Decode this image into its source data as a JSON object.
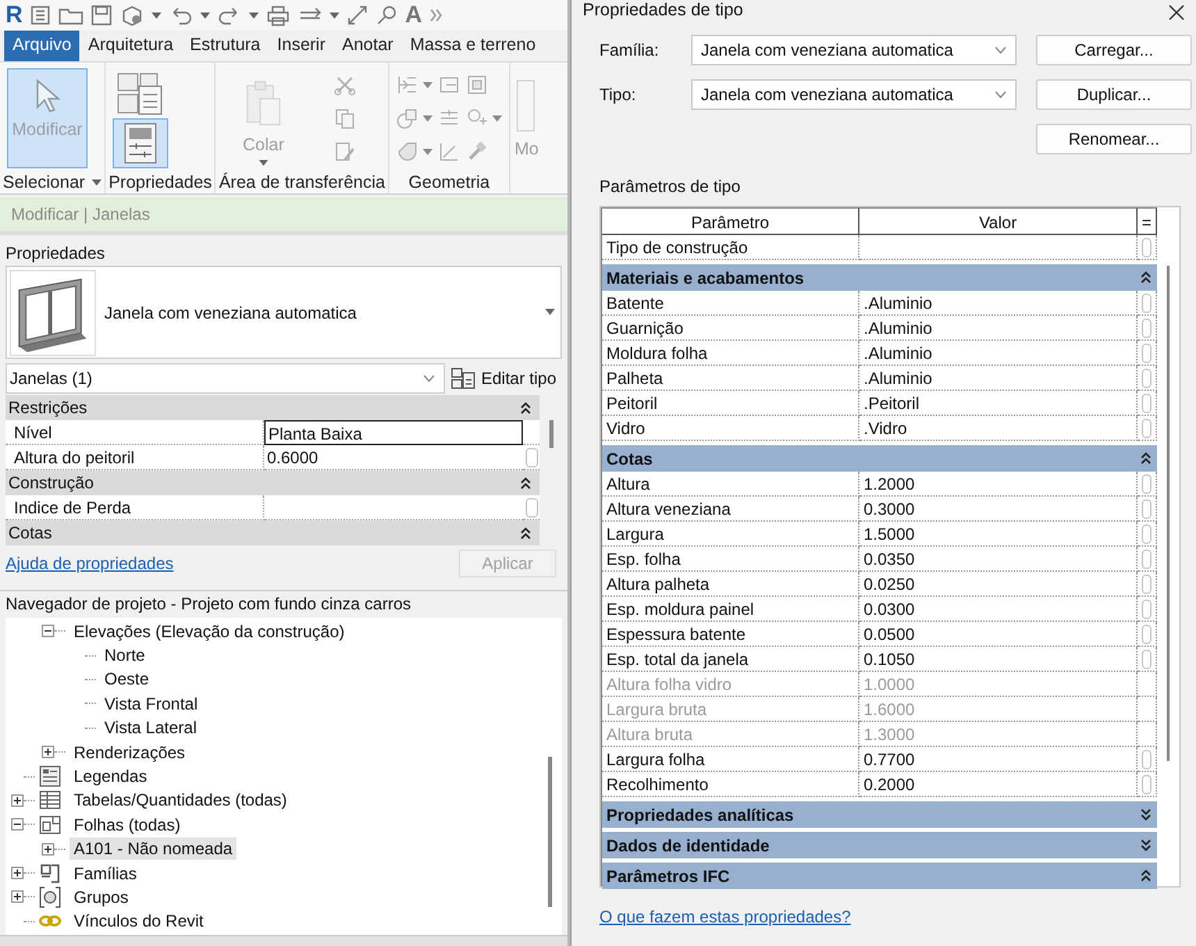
{
  "app": {
    "logo": "R",
    "text_tool": "A"
  },
  "ribbon": {
    "tabs": [
      {
        "label": "Arquivo",
        "selected": true
      },
      {
        "label": "Arquitetura",
        "selected": false
      },
      {
        "label": "Estrutura",
        "selected": false
      },
      {
        "label": "Inserir",
        "selected": false
      },
      {
        "label": "Anotar",
        "selected": false
      },
      {
        "label": "Massa e terreno",
        "selected": false
      }
    ],
    "panels": [
      {
        "label": "Selecionar",
        "dropdown": true,
        "tools": [
          {
            "kind": "large",
            "label": "Modificar",
            "selected": true,
            "disabled": true
          }
        ]
      },
      {
        "label": "Propriedades",
        "dropdown": false,
        "tools": [
          {
            "kind": "icon_large",
            "selected": false
          },
          {
            "kind": "icon_large",
            "selected": true
          }
        ]
      },
      {
        "label": "Área de transferência",
        "dropdown": false,
        "tools": [
          {
            "kind": "large",
            "label": "Colar",
            "selected": false,
            "disabled": true,
            "dropdown": true
          },
          {
            "kind": "small",
            "disabled": true
          },
          {
            "kind": "small",
            "disabled": true
          },
          {
            "kind": "small",
            "disabled": true
          }
        ]
      },
      {
        "label": "Geometria",
        "dropdown": false,
        "tools": [
          {
            "kind": "small",
            "disabled": true,
            "dropdown": true
          },
          {
            "kind": "small",
            "disabled": true,
            "dropdown": true
          },
          {
            "kind": "small",
            "disabled": true,
            "dropdown": true
          },
          {
            "kind": "small",
            "disabled": true
          },
          {
            "kind": "small",
            "disabled": true
          },
          {
            "kind": "small",
            "disabled": true
          },
          {
            "kind": "small",
            "disabled": true
          },
          {
            "kind": "small",
            "disabled": true,
            "dropdown": true
          },
          {
            "kind": "small",
            "disabled": true
          }
        ]
      },
      {
        "dropdown": false,
        "tools": [
          {
            "kind": "large",
            "label": "Mo",
            "selected": false,
            "disabled": true
          }
        ]
      }
    ]
  },
  "context": "Modificar | Janelas",
  "properties": {
    "title": "Propriedades",
    "type_name": "Janela com veneziana automatica",
    "filter": "Janelas (1)",
    "edit_type": "Editar tipo",
    "groups": [
      {
        "label": "Restrições",
        "expanded": true,
        "rows": [
          {
            "name": "Nível",
            "value": "Planta Baixa",
            "selected": true
          },
          {
            "name": "Altura do peitoril",
            "value": "0.6000",
            "selected": false
          }
        ]
      },
      {
        "label": "Construção",
        "expanded": true,
        "rows": [
          {
            "name": "Indice de Perda",
            "selected": false
          }
        ]
      },
      {
        "label": "Cotas",
        "expanded": true
      }
    ],
    "help_link": "Ajuda de propriedades",
    "apply": {
      "label": "Aplicar",
      "disabled": true
    }
  },
  "browser": {
    "title": "Navegador de projeto - Projeto com fundo cinza carros",
    "items": [
      {
        "kind": "hidden_parent",
        "children": [
          {
            "label": "Elevações (Elevação da construção)",
            "expanded": true,
            "selected": false,
            "children": [
              {
                "label": "Norte",
                "selected": false
              },
              {
                "label": "Oeste",
                "selected": false
              },
              {
                "label": "Vista Frontal",
                "selected": false
              },
              {
                "label": "Vista Lateral",
                "selected": false
              }
            ]
          },
          {
            "label": "Renderizações",
            "expanded": false,
            "selected": false
          }
        ]
      },
      {
        "kind": "legend",
        "label": "Legendas",
        "selected": false
      },
      {
        "kind": "schedule",
        "label": "Tabelas/Quantidades (todas)",
        "expanded": false,
        "selected": false
      },
      {
        "kind": "sheet",
        "label": "Folhas (todas)",
        "expanded": true,
        "selected": false,
        "children": [
          {
            "label": "A101 - Não nomeada",
            "expanded": false,
            "selected": true
          }
        ]
      },
      {
        "kind": "family",
        "label": "Famílias",
        "expanded": false,
        "selected": false
      },
      {
        "kind": "group",
        "label": "Grupos",
        "expanded": false,
        "selected": false
      },
      {
        "kind": "link",
        "label": "Vínculos do Revit",
        "selected": false
      }
    ]
  },
  "dialog": {
    "title": "Propriedades de tipo",
    "family_label": "Família:",
    "family": "Janela com veneziana automatica",
    "type_label": "Tipo:",
    "type": "Janela com veneziana automatica",
    "buttons": [
      "Carregar...",
      "Duplicar...",
      "Renomear..."
    ],
    "section": "Parâmetros de tipo",
    "columns": [
      "Parâmetro",
      "Valor",
      "="
    ],
    "rows": [
      {
        "kind": "param",
        "name": "Tipo de construção",
        "disabled": false
      },
      {
        "kind": "group",
        "label": "Materiais e acabamentos",
        "expanded": true
      },
      {
        "kind": "param",
        "name": "Batente",
        "value": ".Aluminio",
        "disabled": false
      },
      {
        "kind": "param",
        "name": "Guarnição",
        "value": ".Aluminio",
        "disabled": false
      },
      {
        "kind": "param",
        "name": "Moldura folha",
        "value": ".Aluminio",
        "disabled": false
      },
      {
        "kind": "param",
        "name": "Palheta",
        "value": ".Aluminio",
        "disabled": false
      },
      {
        "kind": "param",
        "name": "Peitoril",
        "value": ".Peitoril",
        "disabled": false
      },
      {
        "kind": "param",
        "name": "Vidro",
        "value": ".Vidro",
        "disabled": false
      },
      {
        "kind": "group",
        "label": "Cotas",
        "expanded": true
      },
      {
        "kind": "param",
        "name": "Altura",
        "value": "1.2000",
        "disabled": false
      },
      {
        "kind": "param",
        "name": "Altura veneziana",
        "value": "0.3000",
        "disabled": false
      },
      {
        "kind": "param",
        "name": "Largura",
        "value": "1.5000",
        "disabled": false
      },
      {
        "kind": "param",
        "name": "Esp. folha",
        "value": "0.0350",
        "disabled": false
      },
      {
        "kind": "param",
        "name": "Altura palheta",
        "value": "0.0250",
        "disabled": false
      },
      {
        "kind": "param",
        "name": "Esp. moldura painel",
        "value": "0.0300",
        "disabled": false
      },
      {
        "kind": "param",
        "name": "Espessura batente",
        "value": "0.0500",
        "disabled": false
      },
      {
        "kind": "param",
        "name": "Esp. total da janela",
        "value": "0.1050",
        "disabled": false
      },
      {
        "kind": "param",
        "name": "Altura folha vidro",
        "value": "1.0000",
        "disabled": true
      },
      {
        "kind": "param",
        "name": "Largura bruta",
        "value": "1.6000",
        "disabled": true
      },
      {
        "kind": "param",
        "name": "Altura bruta",
        "value": "1.3000",
        "disabled": true
      },
      {
        "kind": "param",
        "name": "Largura folha",
        "value": "0.7700",
        "disabled": false
      },
      {
        "kind": "param",
        "name": "Recolhimento",
        "value": "0.2000",
        "disabled": false
      },
      {
        "kind": "group",
        "label": "Propriedades analíticas",
        "expanded": false
      },
      {
        "kind": "group",
        "label": "Dados de identidade",
        "expanded": false
      },
      {
        "kind": "group",
        "label": "Parâmetros IFC",
        "expanded": true
      }
    ],
    "help_link": "O que fazem estas propriedades?"
  }
}
